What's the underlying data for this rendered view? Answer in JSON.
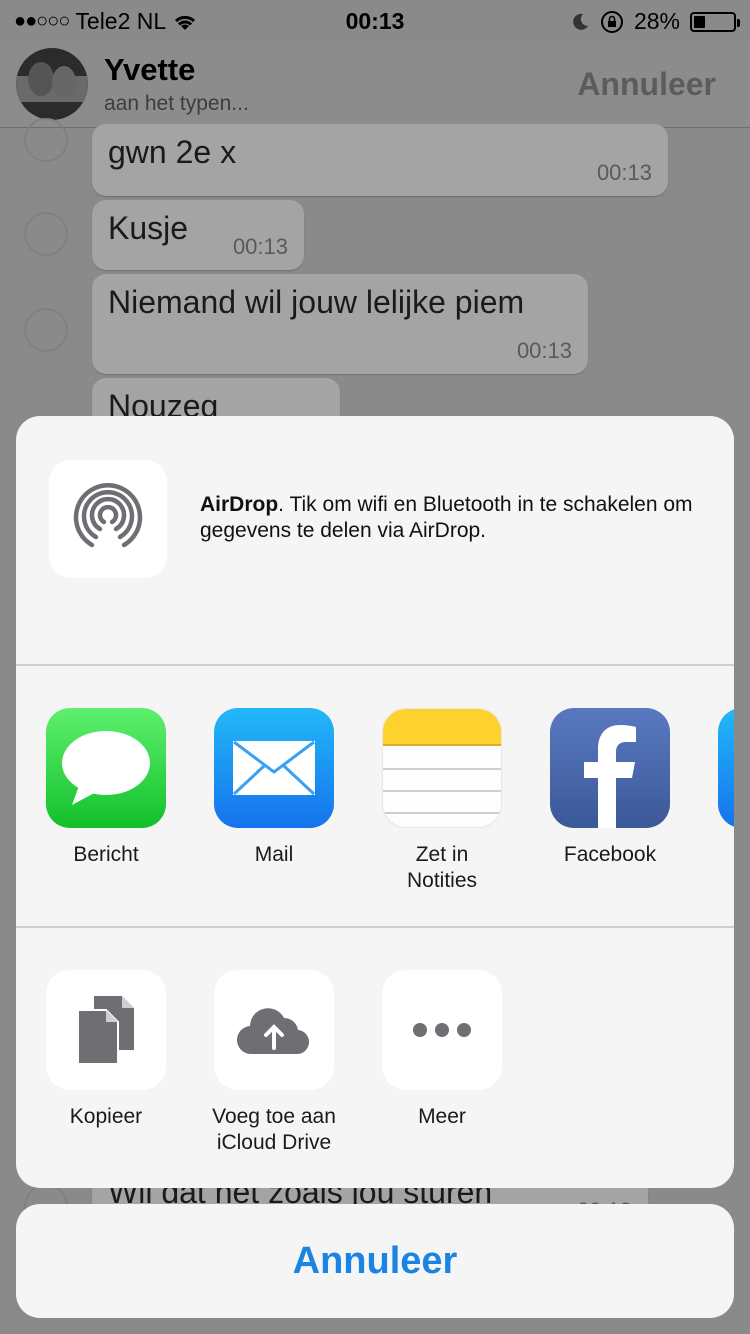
{
  "status_bar": {
    "signal": "●●○○○",
    "carrier": "Tele2 NL",
    "time": "00:13",
    "battery": "28%",
    "battery_level": 0.28
  },
  "chat_header": {
    "name": "Yvette",
    "status": "aan het typen...",
    "cancel_label": "Annuleer"
  },
  "messages": [
    {
      "text": "gwn 2e x",
      "time": "00:13"
    },
    {
      "text": "Kusje",
      "time": "00:13"
    },
    {
      "text": "Niemand wil jouw lelijke piem",
      "time": "00:13"
    },
    {
      "text": "Nouzeg",
      "time": ""
    },
    {
      "text": "Wil dat het zoals jou sturen",
      "time": "00:13"
    }
  ],
  "share_sheet": {
    "airdrop": {
      "title": "AirDrop",
      "description": ". Tik om wifi en Bluetooth in te schakelen om gegevens te delen via AirDrop."
    },
    "apps": [
      {
        "label": "Bericht",
        "icon": "messages-icon"
      },
      {
        "label": "Mail",
        "icon": "mail-icon"
      },
      {
        "label": "Zet in\nNotities",
        "icon": "notes-icon"
      },
      {
        "label": "Facebook",
        "icon": "facebook-icon"
      }
    ],
    "actions": [
      {
        "label": "Kopieer",
        "icon": "copy-icon"
      },
      {
        "label": "Voeg toe aan\niCloud Drive",
        "icon": "icloud-upload-icon"
      },
      {
        "label": "Meer",
        "icon": "more-icon"
      }
    ],
    "cancel_label": "Annuleer"
  },
  "colors": {
    "accent": "#1a84e4",
    "sheet_background": "#f5f5f5",
    "messages_green": "#12c02a",
    "mail_blue": "#1573ed",
    "facebook_blue": "#3b5998",
    "notes_yellow": "#fdd22e"
  }
}
